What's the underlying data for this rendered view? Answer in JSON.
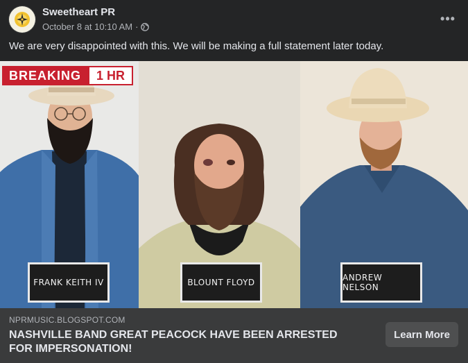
{
  "post": {
    "page_name": "Sweetheart PR",
    "timestamp": "October 8 at 10:10 AM",
    "separator": "·",
    "privacy_icon": "globe-icon",
    "more_icon": "more-options-icon",
    "more_label": "•••",
    "text": "We are very disappointed with this. We will be making a full statement later today."
  },
  "image": {
    "banner": {
      "word": "BREAKING",
      "time": "1 HR"
    },
    "nameplates": [
      "FRANK KEITH IV",
      "BLOUNT FLOYD",
      "ANDREW NELSON"
    ]
  },
  "link": {
    "domain": "NPRMUSIC.BLOGSPOT.COM",
    "headline": "NASHVILLE BAND GREAT PEACOCK HAVE BEEN ARRESTED FOR IMPERSONATION!",
    "cta": "Learn More"
  },
  "colors": {
    "background": "#242526",
    "footer": "#3a3b3c",
    "button": "#4e4f50",
    "banner_red": "#c8202f"
  }
}
